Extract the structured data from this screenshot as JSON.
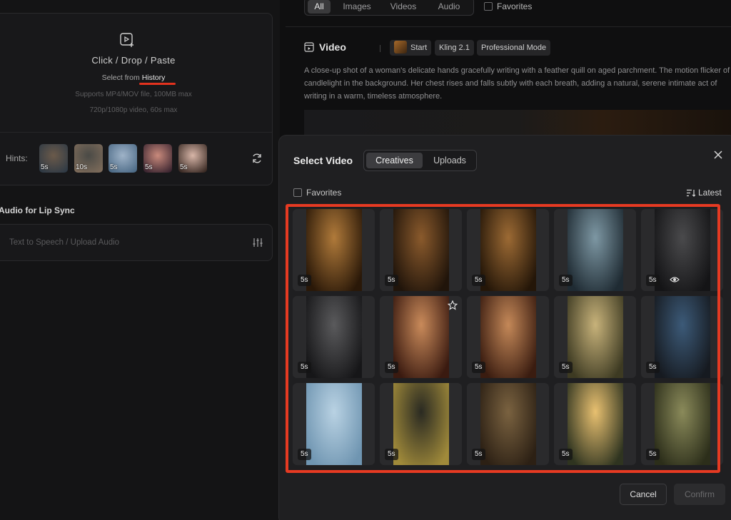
{
  "upload": {
    "title": "Click / Drop / Paste",
    "select_from": "Select from",
    "history_link": "History",
    "support_line1": "Supports MP4/MOV file, 100MB max",
    "support_line2": "720p/1080p video, 60s max"
  },
  "hints": {
    "label": "Hints:",
    "items": [
      {
        "duration": "5s",
        "colors": [
          "#6b5a4a",
          "#2f3a45"
        ]
      },
      {
        "duration": "10s",
        "colors": [
          "#4a4a46",
          "#7d6b5a"
        ]
      },
      {
        "duration": "5s",
        "colors": [
          "#9fb3c8",
          "#4c6a86"
        ]
      },
      {
        "duration": "5s",
        "colors": [
          "#c98a7c",
          "#3b2530"
        ]
      },
      {
        "duration": "5s",
        "colors": [
          "#d8b6a8",
          "#3a2a24"
        ]
      }
    ]
  },
  "audio": {
    "title": "Audio for Lip Sync",
    "placeholder": "Text to Speech / Upload Audio"
  },
  "filters": {
    "tabs": [
      "All",
      "Images",
      "Videos",
      "Audio"
    ],
    "active": "All",
    "favorites": "Favorites"
  },
  "video_item": {
    "label": "Video",
    "chips": [
      "Start",
      "Kling 2.1",
      "Professional Mode"
    ],
    "prompt": "A close-up shot of a woman's delicate hands gracefully writing with a feather quill on aged parchment. The motion flicker of candlelight in the background. Her chest rises and falls subtly with each breath, adding a natural, serene intimate act of writing in a warm, timeless atmosphere."
  },
  "modal": {
    "title": "Select Video",
    "tabs": [
      "Creatives",
      "Uploads"
    ],
    "active_tab": "Creatives",
    "favorites": "Favorites",
    "sort": "Latest",
    "cancel": "Cancel",
    "confirm": "Confirm",
    "tiles": [
      {
        "duration": "5s",
        "colors": [
          "#b07a3a",
          "#2a1808"
        ],
        "icon": ""
      },
      {
        "duration": "5s",
        "colors": [
          "#8a5a2c",
          "#20140a"
        ],
        "icon": ""
      },
      {
        "duration": "5s",
        "colors": [
          "#9c6a34",
          "#241608"
        ],
        "icon": ""
      },
      {
        "duration": "5s",
        "colors": [
          "#7d97a3",
          "#1f2b33"
        ],
        "icon": ""
      },
      {
        "duration": "5s",
        "colors": [
          "#4a4a4c",
          "#141416"
        ],
        "icon": "eye-icon"
      },
      {
        "duration": "5s",
        "colors": [
          "#5a5a5c",
          "#161618"
        ],
        "icon": ""
      },
      {
        "duration": "5s",
        "colors": [
          "#c98a5a",
          "#3a1a10"
        ],
        "icon": "star-icon"
      },
      {
        "duration": "5s",
        "colors": [
          "#c48858",
          "#3a1c10"
        ],
        "icon": ""
      },
      {
        "duration": "5s",
        "colors": [
          "#c7b27a",
          "#3d3a22"
        ],
        "icon": ""
      },
      {
        "duration": "5s",
        "colors": [
          "#3c5a78",
          "#161a20"
        ],
        "icon": ""
      },
      {
        "duration": "5s",
        "colors": [
          "#b9d2e3",
          "#6f95b1"
        ],
        "icon": ""
      },
      {
        "duration": "5s",
        "colors": [
          "#2a2a22",
          "#a08a3a"
        ],
        "icon": ""
      },
      {
        "duration": "5s",
        "colors": [
          "#7a6240",
          "#2c2014"
        ],
        "icon": ""
      },
      {
        "duration": "5s",
        "colors": [
          "#e8c070",
          "#2f3420"
        ],
        "icon": ""
      },
      {
        "duration": "5s",
        "colors": [
          "#8a8a5a",
          "#2c2e1a"
        ],
        "icon": ""
      }
    ]
  }
}
